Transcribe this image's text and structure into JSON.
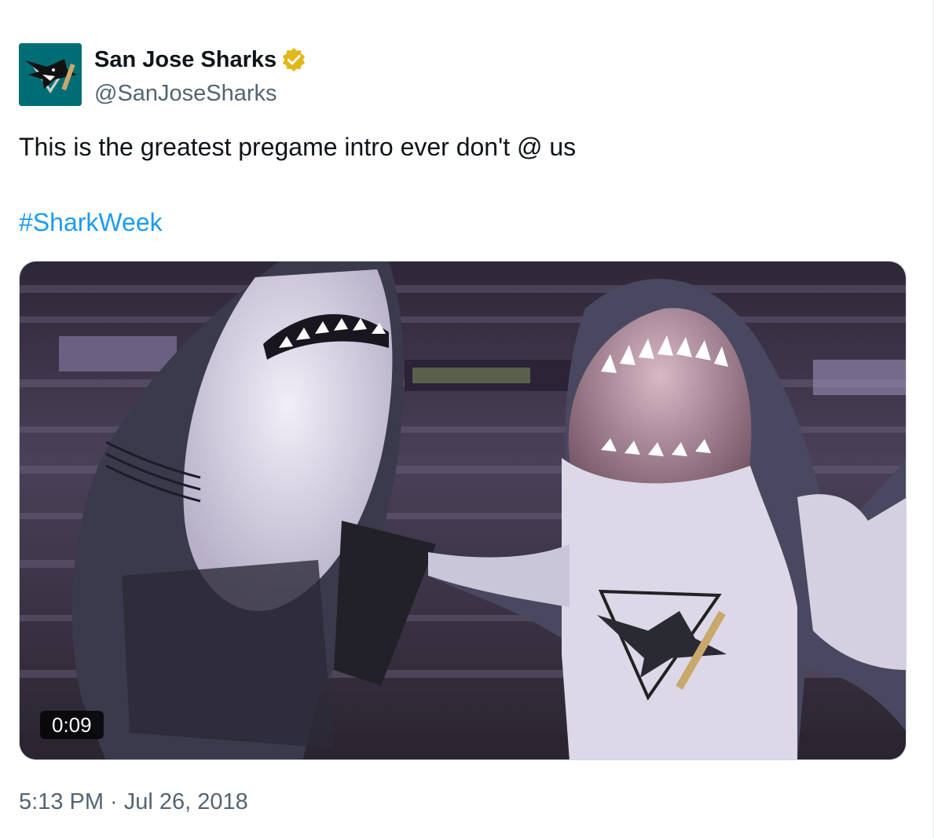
{
  "tweet": {
    "author": {
      "display_name": "San Jose Sharks",
      "handle": "@SanJoseSharks",
      "verified": true,
      "verified_badge_color": "#e2b719",
      "avatar_background": "#006d75"
    },
    "text": "This is the greatest pregame intro ever don't @ us",
    "hashtag": "#SharkWeek",
    "hashtag_color": "#1d9bf0",
    "media": {
      "type": "video",
      "duration": "0:09"
    },
    "timestamp": "5:13 PM · Jul 26, 2018"
  }
}
